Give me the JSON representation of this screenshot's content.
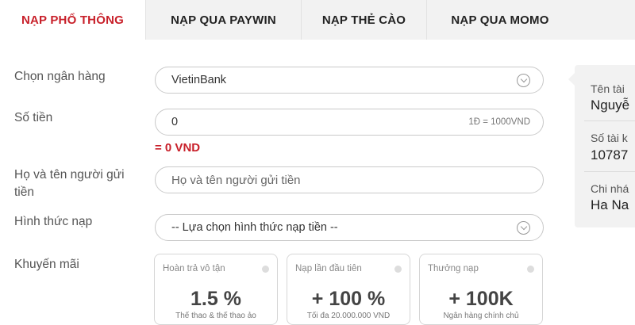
{
  "tabs": [
    {
      "label": "NẠP PHỔ THÔNG",
      "active": true
    },
    {
      "label": "NẠP QUA PAYWIN",
      "active": false
    },
    {
      "label": "NẠP THẺ CÀO",
      "active": false
    },
    {
      "label": "NẠP QUA MOMO",
      "active": false
    }
  ],
  "form": {
    "bank_label": "Chọn ngân hàng",
    "bank_value": "VietinBank",
    "amount_label": "Số tiền",
    "amount_value": "0",
    "amount_rate": "1Đ = 1000VND",
    "amount_converted": "= 0 VND",
    "sender_label": "Họ và tên người gửi tiền",
    "sender_placeholder": "Họ và tên người gửi tiền",
    "method_label": "Hình thức nạp",
    "method_value": "-- Lựa chọn hình thức nạp tiền --",
    "promo_label": "Khuyến mãi"
  },
  "promotions": [
    {
      "title": "Hoàn trả vô tận",
      "value": "1.5 %",
      "note": "Thể thao & thể thao ảo"
    },
    {
      "title": "Nạp lần đầu tiên",
      "value": "+ 100 %",
      "note": "Tối đa 20.000.000 VND"
    },
    {
      "title": "Thưởng nạp",
      "value": "+ 100K",
      "note": "Ngân hàng chính chủ"
    }
  ],
  "account_panel": {
    "name_label": "Tên tài",
    "name_value": "Nguyễ",
    "number_label": "Số tài k",
    "number_value": "10787",
    "branch_label": "Chi nhá",
    "branch_value": "Ha Na"
  },
  "colors": {
    "accent": "#c8202a",
    "tab_bg": "#f2f2f2"
  }
}
